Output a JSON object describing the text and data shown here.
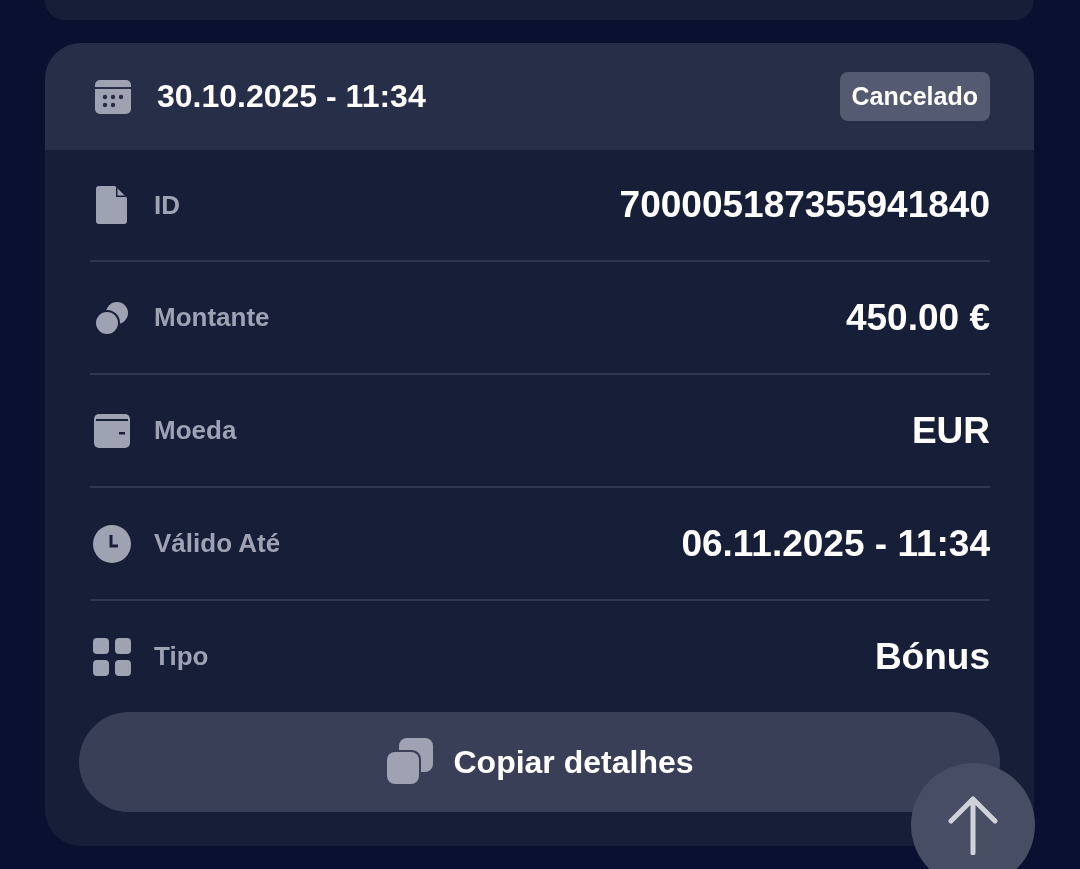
{
  "transaction": {
    "date": "30.10.2025 - 11:34",
    "status": "Cancelado",
    "details": [
      {
        "label": "ID",
        "value": "700005187355941840"
      },
      {
        "label": "Montante",
        "value": "450.00 €"
      },
      {
        "label": "Moeda",
        "value": "EUR"
      },
      {
        "label": "Válido Até",
        "value": "06.11.2025 - 11:34"
      },
      {
        "label": "Tipo",
        "value": "Bónus"
      }
    ],
    "copy_button": "Copiar detalhes"
  }
}
